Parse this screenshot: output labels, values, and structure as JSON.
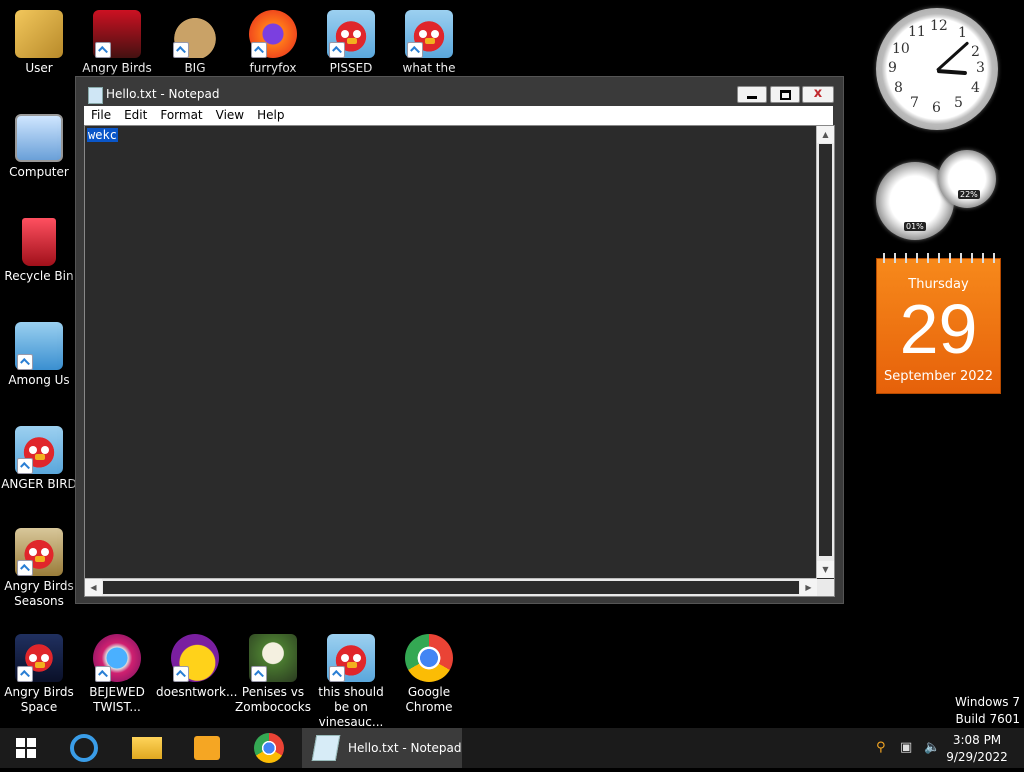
{
  "desktop_icons": [
    {
      "label": "User"
    },
    {
      "label": "Angry Birds"
    },
    {
      "label": "BIG"
    },
    {
      "label": "furryfox"
    },
    {
      "label": "PISSED BIRDS"
    },
    {
      "label": "what the fuck"
    },
    {
      "label": "Computer"
    },
    {
      "label": "Recycle Bin"
    },
    {
      "label": "Among Us"
    },
    {
      "label": "ANGER BIRD"
    },
    {
      "label": "Angry Birds Seasons"
    },
    {
      "label": "Angry Birds Space"
    },
    {
      "label": "BEJEWED TWIST..."
    },
    {
      "label": "doesntwork..."
    },
    {
      "label": "Penises vs Zombococks"
    },
    {
      "label": "this should be on vinesauc..."
    },
    {
      "label": "Google Chrome"
    }
  ],
  "notepad": {
    "title": "Hello.txt - Notepad",
    "menu": [
      "File",
      "Edit",
      "Format",
      "View",
      "Help"
    ],
    "content": "wekc",
    "close_glyph": "x"
  },
  "gadgets": {
    "clock_numbers": [
      "12",
      "1",
      "2",
      "3",
      "4",
      "5",
      "6",
      "7",
      "8",
      "9",
      "10",
      "11"
    ],
    "cpu_percent": "01%",
    "ram_percent": "22%",
    "calendar": {
      "weekday": "Thursday",
      "day": "29",
      "month_year": "September 2022"
    }
  },
  "watermark": {
    "line1": "Windows 7",
    "line2": "Build 7601"
  },
  "taskbar": {
    "active_window": "Hello.txt - Notepad",
    "time": "3:08 PM",
    "date": "9/29/2022"
  },
  "colors": {
    "accent_orange": "#f7891b",
    "selection_blue": "#0a56c8",
    "editor_bg": "#2b2b2b"
  }
}
